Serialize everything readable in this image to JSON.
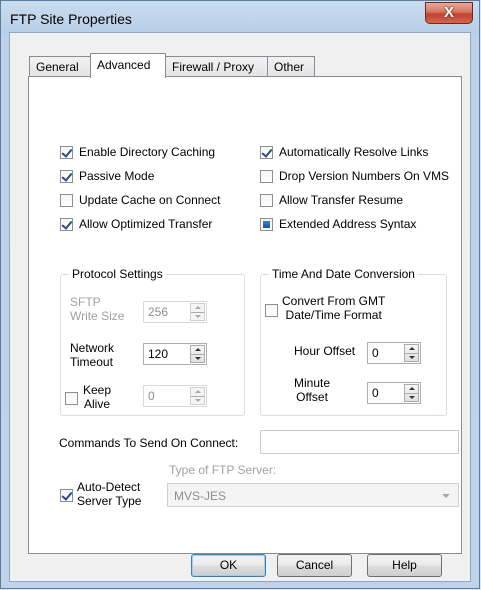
{
  "window": {
    "title": "FTP Site Properties",
    "close_glyph": "X"
  },
  "tabs": [
    {
      "label": "General",
      "active": false
    },
    {
      "label": "Advanced",
      "active": true
    },
    {
      "label": "Firewall / Proxy",
      "active": false
    },
    {
      "label": "Other",
      "active": false
    }
  ],
  "options_left": [
    {
      "label": "Enable Directory Caching",
      "checked": true
    },
    {
      "label": "Passive Mode",
      "checked": true
    },
    {
      "label": "Update Cache on Connect",
      "checked": false
    },
    {
      "label": "Allow Optimized Transfer",
      "checked": true
    }
  ],
  "options_right": [
    {
      "label": "Automatically Resolve Links",
      "checked": true
    },
    {
      "label": "Drop Version Numbers On VMS",
      "checked": false
    },
    {
      "label": "Allow Transfer Resume",
      "checked": false
    },
    {
      "label": "Extended Address Syntax",
      "state": "indeterminate"
    }
  ],
  "protocol": {
    "title": "Protocol Settings",
    "sftp_label_1": "SFTP",
    "sftp_label_2": "Write Size",
    "sftp_value": "256",
    "net_label_1": "Network",
    "net_label_2": "Timeout",
    "net_value": "120",
    "keep_label_1": "Keep",
    "keep_label_2": "Alive",
    "keep_value": "0",
    "keep_checked": false
  },
  "timedate": {
    "title": "Time And Date Conversion",
    "gmt_label_1": "Convert From GMT",
    "gmt_label_2": "Date/Time Format",
    "gmt_checked": false,
    "hour_label": "Hour Offset",
    "hour_value": "0",
    "minute_label_1": "Minute",
    "minute_label_2": "Offset",
    "minute_value": "0"
  },
  "commands": {
    "label": "Commands To Send On Connect:",
    "value": ""
  },
  "server": {
    "autodetect_label_1": "Auto-Detect",
    "autodetect_label_2": "Server Type",
    "autodetect_checked": true,
    "type_label": "Type of FTP Server:",
    "type_value": "MVS-JES"
  },
  "buttons": {
    "ok": "OK",
    "cancel": "Cancel",
    "help": "Help"
  }
}
